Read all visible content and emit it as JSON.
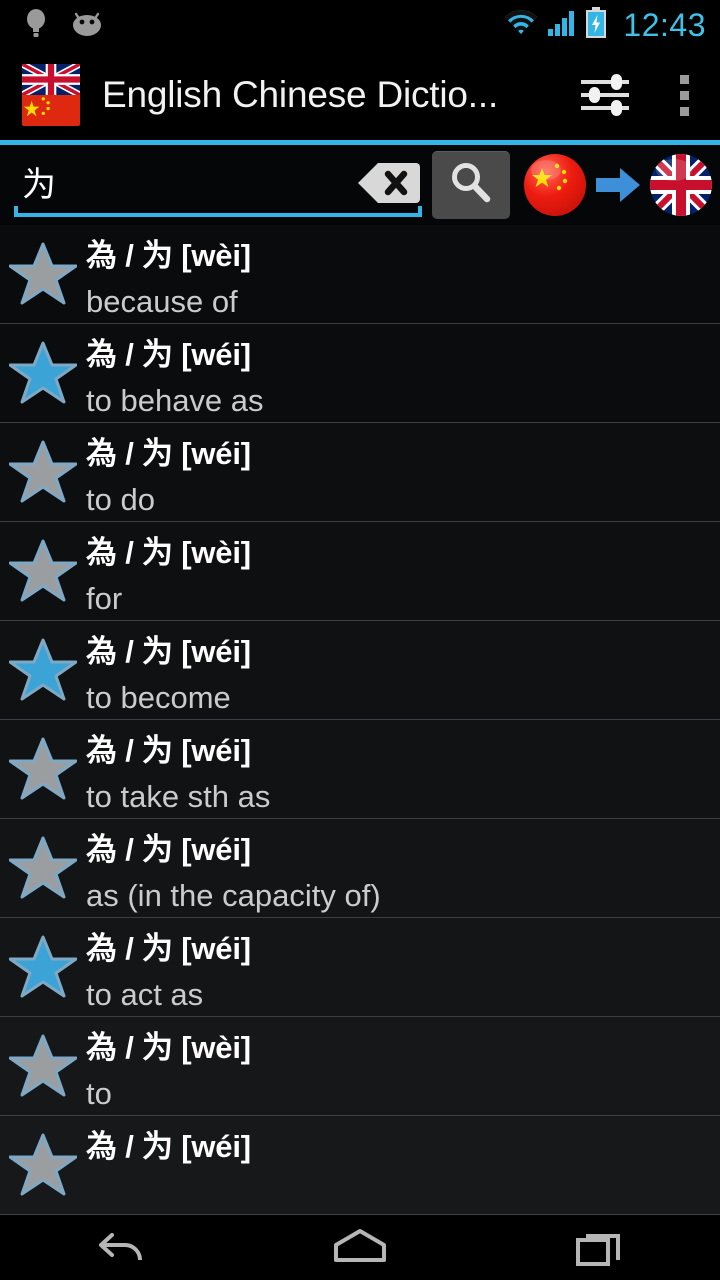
{
  "statusbar": {
    "clock": "12:43",
    "icons": [
      "lightbulb-icon",
      "android-icon",
      "wifi-icon",
      "signal-icon",
      "battery-charging-icon"
    ]
  },
  "actionbar": {
    "title": "English Chinese Dictio...",
    "app_icon": "uk-cn-flag-icon",
    "settings_icon": "sliders-icon",
    "overflow_icon": "overflow-menu-icon"
  },
  "search": {
    "value": "为",
    "placeholder": "",
    "clear_label": "clear-icon",
    "search_label": "search-icon",
    "source_lang": "Chinese",
    "target_lang": "English",
    "direction_icon": "arrow-right-icon"
  },
  "results": [
    {
      "headword": "為 / 为 [wèi]",
      "definition": "because of",
      "starred": false
    },
    {
      "headword": "為 / 为 [wéi]",
      "definition": "to behave as",
      "starred": true
    },
    {
      "headword": "為 / 为 [wéi]",
      "definition": "to do",
      "starred": false
    },
    {
      "headword": "為 / 为 [wèi]",
      "definition": "for",
      "starred": false
    },
    {
      "headword": "為 / 为 [wéi]",
      "definition": "to become",
      "starred": true
    },
    {
      "headword": "為 / 为 [wéi]",
      "definition": "to take sth as",
      "starred": false
    },
    {
      "headword": "為 / 为 [wéi]",
      "definition": "as (in the capacity of)",
      "starred": false
    },
    {
      "headword": "為 / 为 [wéi]",
      "definition": "to act as",
      "starred": true
    },
    {
      "headword": "為 / 为 [wèi]",
      "definition": "to",
      "starred": false
    },
    {
      "headword": "為 / 为 [wéi]",
      "definition": "",
      "starred": false
    }
  ],
  "navbar": {
    "back": "back-icon",
    "home": "home-icon",
    "recents": "recents-icon"
  },
  "colors": {
    "accent_blue": "#33b5e5",
    "clock_blue": "#3ec3e8",
    "star_on": "#3ba3d6",
    "star_off": "#9a9ea1",
    "list_bg": "#0a0b0d",
    "divider": "#3a3f45"
  }
}
